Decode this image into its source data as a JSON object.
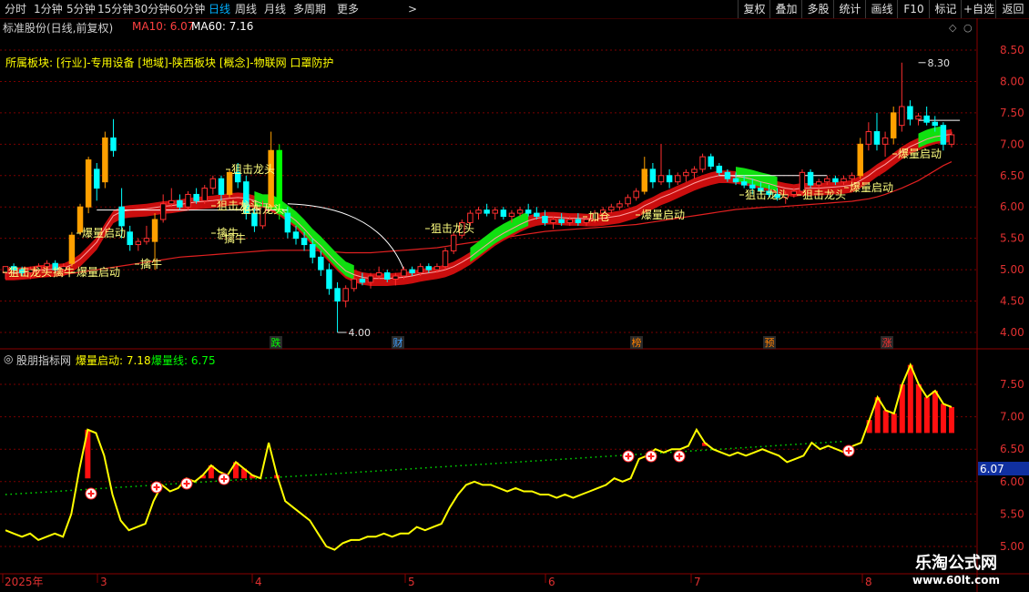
{
  "toolbar": {
    "periods": [
      {
        "label": "分时",
        "active": false
      },
      {
        "label": "1分钟",
        "active": false
      },
      {
        "label": "5分钟",
        "active": false
      },
      {
        "label": "15分钟",
        "active": false
      },
      {
        "label": "30分钟",
        "active": false
      },
      {
        "label": "60分钟",
        "active": false
      },
      {
        "label": "日线",
        "active": true
      },
      {
        "label": "周线",
        "active": false
      },
      {
        "label": "月线",
        "active": false
      },
      {
        "label": "多周期",
        "active": false
      },
      {
        "label": "更多",
        "active": false
      }
    ],
    "right_buttons": [
      "复权",
      "叠加",
      "多股",
      "统计",
      "画线",
      "F10",
      "标记",
      "+自选",
      "返回"
    ]
  },
  "main_panel": {
    "title": "标准股份(日线,前复权)",
    "ma10_label": "MA10: 6.07",
    "ma60_label": "MA60: 7.16",
    "sector_text": "所属板块: [行业]-专用设备 [地域]-陕西板块 [概念]-物联网 口罩防护",
    "high_label": "8.30",
    "low_label": "4.00",
    "y_ticks": [
      "8.50",
      "8.00",
      "7.50",
      "7.00",
      "6.50",
      "6.00",
      "5.50",
      "5.00",
      "4.50",
      "4.00"
    ],
    "annotations": [
      {
        "text": "狙击龙头"
      },
      {
        "text": "擒牛"
      },
      {
        "text": "爆量启动"
      },
      {
        "text": "狙击龙头"
      },
      {
        "text": "擒牛"
      },
      {
        "text": "爆量启动"
      },
      {
        "text": "擒牛"
      },
      {
        "text": "狙击龙头"
      },
      {
        "text": "擒牛"
      },
      {
        "text": "狙击龙头"
      },
      {
        "text": "狙击龙头"
      },
      {
        "text": "加仓"
      },
      {
        "text": "爆量启动"
      },
      {
        "text": "狙击龙头"
      },
      {
        "text": "狙击龙头"
      },
      {
        "text": "爆量启动"
      },
      {
        "text": "爆量启动"
      }
    ],
    "markers": [
      {
        "text": "跌",
        "color": "#00ff00"
      },
      {
        "text": "财",
        "color": "#3fa0ff"
      },
      {
        "text": "榜",
        "color": "#ff8000"
      },
      {
        "text": "预",
        "color": "#ff8000"
      },
      {
        "text": "涨",
        "color": "#ff3030"
      }
    ]
  },
  "sub_panel": {
    "title": "股朋指标网",
    "label1": "爆量启动: 7.18",
    "label2": "爆量线: 6.75",
    "y_ticks": [
      "7.50",
      "7.00",
      "6.50",
      "6.00",
      "5.50",
      "5.00"
    ],
    "current_value": "6.07"
  },
  "x_axis": {
    "labels": [
      "2025年",
      "3",
      "4",
      "5",
      "6",
      "7",
      "8"
    ]
  },
  "watermark": {
    "line1": "乐淘公式网",
    "line2": "www.60lt.com"
  },
  "colors": {
    "up": "#ff3030",
    "down": "#00ffff",
    "orange": "#ffa000",
    "yellow": "#ffff00",
    "green": "#00ff00",
    "grid": "#7a0000"
  },
  "chart_data": {
    "type": "candlestick",
    "ylim_main": [
      3.9,
      8.7
    ],
    "ylim_sub": [
      4.95,
      8.0
    ],
    "candles": [
      [
        4.95,
        5.05,
        4.85,
        5.05
      ],
      [
        5.05,
        5.1,
        4.95,
        5.0
      ],
      [
        5.0,
        5.05,
        4.9,
        4.95
      ],
      [
        4.95,
        5.05,
        4.85,
        5.0
      ],
      [
        5.0,
        5.1,
        4.95,
        5.05
      ],
      [
        5.05,
        5.15,
        5.0,
        5.1
      ],
      [
        5.1,
        5.15,
        4.95,
        5.0
      ],
      [
        5.0,
        5.1,
        4.95,
        5.05
      ],
      [
        5.1,
        5.6,
        5.05,
        5.55
      ],
      [
        5.6,
        6.05,
        5.55,
        6.0
      ],
      [
        6.0,
        6.8,
        5.9,
        6.75
      ],
      [
        6.6,
        6.7,
        6.1,
        6.3
      ],
      [
        6.4,
        7.2,
        6.3,
        7.1
      ],
      [
        7.1,
        7.4,
        6.8,
        6.9
      ],
      [
        6.0,
        6.3,
        5.5,
        5.7
      ],
      [
        5.6,
        5.7,
        5.3,
        5.4
      ],
      [
        5.4,
        5.5,
        5.3,
        5.45
      ],
      [
        5.45,
        5.7,
        5.4,
        5.5
      ],
      [
        5.45,
        5.9,
        5.0,
        5.8
      ],
      [
        5.8,
        6.2,
        5.75,
        6.05
      ],
      [
        6.05,
        6.3,
        6.0,
        6.1
      ],
      [
        6.1,
        6.2,
        5.95,
        6.0
      ],
      [
        6.0,
        6.25,
        5.95,
        6.2
      ],
      [
        6.2,
        6.3,
        6.05,
        6.1
      ],
      [
        6.1,
        6.35,
        6.05,
        6.3
      ],
      [
        6.3,
        6.5,
        6.2,
        6.45
      ],
      [
        6.45,
        6.5,
        6.1,
        6.2
      ],
      [
        6.2,
        6.6,
        6.15,
        6.55
      ],
      [
        6.55,
        6.7,
        6.3,
        6.4
      ],
      [
        6.4,
        6.5,
        5.8,
        5.9
      ],
      [
        5.9,
        6.0,
        5.6,
        5.7
      ],
      [
        5.7,
        6.1,
        5.65,
        6.0
      ],
      [
        6.0,
        7.2,
        5.95,
        6.9
      ],
      [
        6.9,
        7.0,
        5.8,
        5.9
      ],
      [
        5.9,
        6.0,
        5.5,
        5.6
      ],
      [
        5.6,
        5.7,
        5.4,
        5.5
      ],
      [
        5.5,
        5.6,
        5.3,
        5.4
      ],
      [
        5.4,
        5.5,
        5.1,
        5.2
      ],
      [
        5.2,
        5.3,
        4.9,
        5.0
      ],
      [
        5.0,
        5.1,
        4.6,
        4.7
      ],
      [
        4.7,
        4.8,
        4.0,
        4.5
      ],
      [
        4.5,
        4.75,
        4.4,
        4.7
      ],
      [
        4.7,
        4.9,
        4.65,
        4.85
      ],
      [
        4.85,
        4.95,
        4.75,
        4.8
      ],
      [
        4.8,
        4.95,
        4.7,
        4.9
      ],
      [
        4.9,
        5.05,
        4.85,
        4.95
      ],
      [
        4.95,
        5.0,
        4.8,
        4.85
      ],
      [
        4.85,
        4.95,
        4.75,
        4.9
      ],
      [
        4.9,
        5.05,
        4.85,
        5.0
      ],
      [
        5.0,
        5.05,
        4.9,
        4.95
      ],
      [
        4.95,
        5.1,
        4.9,
        5.05
      ],
      [
        5.05,
        5.1,
        4.95,
        5.0
      ],
      [
        5.0,
        5.1,
        4.95,
        5.05
      ],
      [
        5.05,
        5.35,
        5.0,
        5.3
      ],
      [
        5.3,
        5.6,
        5.25,
        5.55
      ],
      [
        5.55,
        5.8,
        5.5,
        5.75
      ],
      [
        5.75,
        5.95,
        5.7,
        5.9
      ],
      [
        5.9,
        6.0,
        5.8,
        5.95
      ],
      [
        5.95,
        6.05,
        5.85,
        5.9
      ],
      [
        5.9,
        6.0,
        5.8,
        5.95
      ],
      [
        5.95,
        6.0,
        5.8,
        5.85
      ],
      [
        5.85,
        5.95,
        5.75,
        5.9
      ],
      [
        5.9,
        6.0,
        5.85,
        5.95
      ],
      [
        5.95,
        6.05,
        5.85,
        5.9
      ],
      [
        5.9,
        6.0,
        5.8,
        5.85
      ],
      [
        5.85,
        5.95,
        5.7,
        5.75
      ],
      [
        5.75,
        5.85,
        5.65,
        5.8
      ],
      [
        5.8,
        5.9,
        5.7,
        5.75
      ],
      [
        5.75,
        5.85,
        5.7,
        5.8
      ],
      [
        5.8,
        5.9,
        5.7,
        5.75
      ],
      [
        5.75,
        5.85,
        5.7,
        5.8
      ],
      [
        5.8,
        5.95,
        5.75,
        5.9
      ],
      [
        5.9,
        6.0,
        5.85,
        5.95
      ],
      [
        5.95,
        6.05,
        5.9,
        6.0
      ],
      [
        6.0,
        6.1,
        5.95,
        6.05
      ],
      [
        6.05,
        6.2,
        6.0,
        6.15
      ],
      [
        6.15,
        6.3,
        6.1,
        6.25
      ],
      [
        6.25,
        6.8,
        6.2,
        6.6
      ],
      [
        6.6,
        6.7,
        6.3,
        6.4
      ],
      [
        6.4,
        7.0,
        6.35,
        6.5
      ],
      [
        6.5,
        6.6,
        6.3,
        6.4
      ],
      [
        6.4,
        6.55,
        6.35,
        6.5
      ],
      [
        6.5,
        6.6,
        6.4,
        6.55
      ],
      [
        6.55,
        6.65,
        6.45,
        6.6
      ],
      [
        6.6,
        6.85,
        6.55,
        6.8
      ],
      [
        6.8,
        6.85,
        6.6,
        6.65
      ],
      [
        6.65,
        6.7,
        6.5,
        6.55
      ],
      [
        6.55,
        6.6,
        6.4,
        6.45
      ],
      [
        6.45,
        6.55,
        6.35,
        6.4
      ],
      [
        6.4,
        6.5,
        6.3,
        6.35
      ],
      [
        6.35,
        6.45,
        6.2,
        6.3
      ],
      [
        6.3,
        6.4,
        6.2,
        6.25
      ],
      [
        6.25,
        6.35,
        6.15,
        6.2
      ],
      [
        6.2,
        6.3,
        6.1,
        6.15
      ],
      [
        6.15,
        6.25,
        6.05,
        6.2
      ],
      [
        6.2,
        6.3,
        6.15,
        6.25
      ],
      [
        6.25,
        6.6,
        6.2,
        6.55
      ],
      [
        6.55,
        6.6,
        6.3,
        6.35
      ],
      [
        6.35,
        6.45,
        6.3,
        6.4
      ],
      [
        6.4,
        6.5,
        6.35,
        6.45
      ],
      [
        6.45,
        6.5,
        6.35,
        6.4
      ],
      [
        6.4,
        6.5,
        6.35,
        6.45
      ],
      [
        6.45,
        6.55,
        6.4,
        6.5
      ],
      [
        6.5,
        7.1,
        6.45,
        7.0
      ],
      [
        7.0,
        7.35,
        6.9,
        7.2
      ],
      [
        7.2,
        7.5,
        6.9,
        7.0
      ],
      [
        7.0,
        7.2,
        6.8,
        7.1
      ],
      [
        7.1,
        7.6,
        7.0,
        7.5
      ],
      [
        7.3,
        8.3,
        7.2,
        7.6
      ],
      [
        7.6,
        7.7,
        7.3,
        7.4
      ],
      [
        7.4,
        7.5,
        7.3,
        7.45
      ],
      [
        7.45,
        7.6,
        7.3,
        7.35
      ],
      [
        7.35,
        7.45,
        7.2,
        7.3
      ],
      [
        7.3,
        7.35,
        6.9,
        7.0
      ],
      [
        7.0,
        7.2,
        6.95,
        7.15
      ]
    ],
    "ma10": [
      4.95,
      4.95,
      4.96,
      4.97,
      4.99,
      5.0,
      5.01,
      5.02,
      5.08,
      5.17,
      5.3,
      5.44,
      5.66,
      5.86,
      5.93,
      5.95,
      5.96,
      5.97,
      5.99,
      6.01,
      6.02,
      6.04,
      6.06,
      6.08,
      6.09,
      6.1,
      6.12,
      6.14,
      6.15,
      6.14,
      6.1,
      6.05,
      6.05,
      5.98,
      5.88,
      5.78,
      5.65,
      5.5,
      5.38,
      5.24,
      5.1,
      4.98,
      4.92,
      4.88,
      4.86,
      4.86,
      4.86,
      4.87,
      4.88,
      4.9,
      4.93,
      4.95,
      4.97,
      5.0,
      5.05,
      5.12,
      5.2,
      5.3,
      5.4,
      5.5,
      5.58,
      5.65,
      5.72,
      5.78,
      5.82,
      5.84,
      5.84,
      5.83,
      5.82,
      5.82,
      5.81,
      5.81,
      5.82,
      5.84,
      5.86,
      5.9,
      5.94,
      6.02,
      6.08,
      6.15,
      6.2,
      6.26,
      6.32,
      6.38,
      6.43,
      6.47,
      6.5,
      6.5,
      6.49,
      6.47,
      6.44,
      6.4,
      6.37,
      6.33,
      6.3,
      6.28,
      6.3,
      6.3,
      6.3,
      6.31,
      6.32,
      6.33,
      6.35,
      6.42,
      6.5,
      6.6,
      6.68,
      6.78,
      6.88,
      6.96,
      7.02,
      7.08,
      7.12,
      7.14,
      7.16
    ],
    "ma60": [
      4.85,
      4.86,
      4.87,
      4.88,
      4.89,
      4.9,
      4.91,
      4.92,
      4.94,
      4.96,
      4.98,
      5.0,
      5.02,
      5.04,
      5.06,
      5.08,
      5.1,
      5.12,
      5.14,
      5.16,
      5.18,
      5.2,
      5.21,
      5.22,
      5.23,
      5.24,
      5.25,
      5.26,
      5.27,
      5.28,
      5.29,
      5.3,
      5.31,
      5.31,
      5.31,
      5.31,
      5.31,
      5.31,
      5.3,
      5.29,
      5.28,
      5.27,
      5.27,
      5.27,
      5.27,
      5.28,
      5.29,
      5.3,
      5.31,
      5.32,
      5.33,
      5.34,
      5.35,
      5.37,
      5.39,
      5.41,
      5.43,
      5.45,
      5.47,
      5.49,
      5.51,
      5.53,
      5.55,
      5.57,
      5.59,
      5.61,
      5.62,
      5.63,
      5.64,
      5.65,
      5.66,
      5.67,
      5.68,
      5.69,
      5.7,
      5.71,
      5.72,
      5.74,
      5.76,
      5.78,
      5.8,
      5.82,
      5.84,
      5.86,
      5.88,
      5.9,
      5.92,
      5.94,
      5.96,
      5.97,
      5.98,
      5.99,
      6.0,
      6.0,
      6.01,
      6.02,
      6.03,
      6.04,
      6.05,
      6.06,
      6.07,
      6.08,
      6.09,
      6.11,
      6.13,
      6.16,
      6.2,
      6.25,
      6.3,
      6.36,
      6.42,
      6.5,
      6.58,
      6.66,
      6.72
    ],
    "sub_yellow": [
      5.25,
      5.2,
      5.15,
      5.2,
      5.1,
      5.15,
      5.2,
      5.15,
      5.5,
      6.2,
      6.8,
      6.75,
      6.4,
      5.8,
      5.4,
      5.25,
      5.3,
      5.35,
      5.7,
      5.95,
      5.85,
      5.9,
      6.05,
      6.0,
      6.1,
      6.25,
      6.15,
      6.1,
      6.3,
      6.2,
      6.1,
      6.05,
      6.6,
      6.1,
      5.7,
      5.6,
      5.5,
      5.4,
      5.2,
      5.0,
      4.95,
      5.05,
      5.1,
      5.1,
      5.15,
      5.15,
      5.2,
      5.15,
      5.2,
      5.2,
      5.3,
      5.25,
      5.3,
      5.35,
      5.6,
      5.8,
      5.95,
      6.0,
      5.95,
      5.95,
      5.9,
      5.85,
      5.9,
      5.85,
      5.85,
      5.8,
      5.8,
      5.75,
      5.8,
      5.75,
      5.8,
      5.85,
      5.9,
      5.95,
      6.05,
      6.0,
      6.05,
      6.35,
      6.4,
      6.5,
      6.45,
      6.5,
      6.5,
      6.55,
      6.8,
      6.6,
      6.5,
      6.45,
      6.4,
      6.45,
      6.4,
      6.45,
      6.5,
      6.45,
      6.4,
      6.3,
      6.35,
      6.4,
      6.6,
      6.5,
      6.55,
      6.5,
      6.45,
      6.55,
      6.6,
      6.95,
      7.3,
      7.1,
      7.05,
      7.5,
      7.8,
      7.5,
      7.3,
      7.4,
      7.2,
      7.15
    ],
    "sub_green_dotted": [
      5.8,
      5.82,
      5.84,
      5.86,
      5.88,
      5.9,
      5.92,
      5.94,
      5.96,
      5.98,
      6.0,
      6.02,
      6.04,
      6.06,
      6.08,
      6.1,
      6.12,
      6.14,
      6.16,
      6.18,
      6.2,
      6.22,
      6.24,
      6.26,
      6.28,
      6.3,
      6.32,
      6.34,
      6.36,
      6.38,
      6.4,
      6.42,
      6.44,
      6.46,
      6.48,
      6.5,
      6.52,
      6.54,
      6.56,
      6.58,
      6.6,
      6.62
    ]
  }
}
